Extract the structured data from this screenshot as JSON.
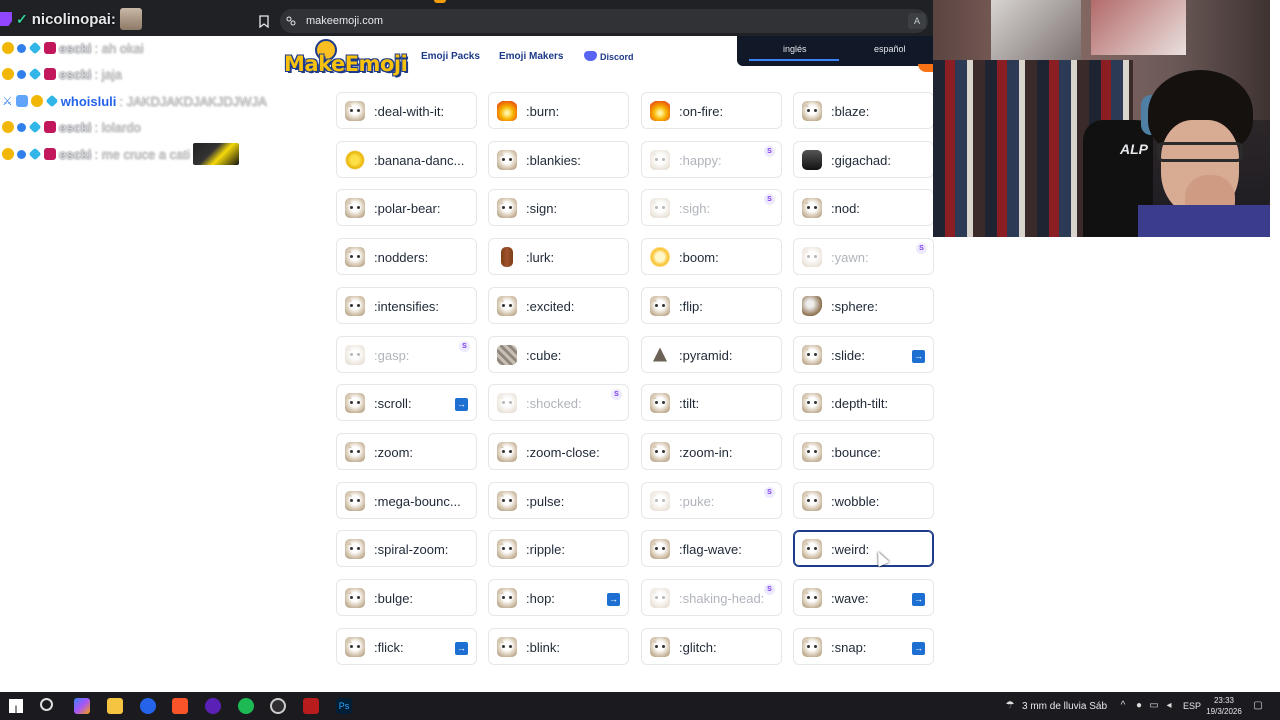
{
  "browser": {
    "url": "makeemoji.com"
  },
  "chat": {
    "top_user": "nicolinopai:",
    "lines": [
      {
        "user": "escki",
        "message": ": ah okai"
      },
      {
        "user": "escki",
        "message": ": jaja"
      },
      {
        "user": "whoisluli",
        "message": ": JAKDJAKDJAKJDJWJA"
      },
      {
        "user": "escki",
        "message": ": lolardo"
      },
      {
        "user": "escki",
        "message": ": me cruce a cati"
      }
    ]
  },
  "site": {
    "logo": "MakeEmoji",
    "nav": {
      "emoji_packs": "Emoji Packs",
      "emoji_makers": "Emoji Makers",
      "discord": "Discord"
    },
    "language": {
      "option1": "inglés",
      "option2": "español",
      "selected": "inglés"
    }
  },
  "emojis": [
    {
      "name": ":deal-with-it:",
      "thumb": "cat"
    },
    {
      "name": ":burn:",
      "thumb": "fire"
    },
    {
      "name": ":on-fire:",
      "thumb": "fire"
    },
    {
      "name": ":blaze:",
      "thumb": "cat"
    },
    {
      "name": ":banana-danc...",
      "thumb": "banana"
    },
    {
      "name": ":blankies:",
      "thumb": "cat"
    },
    {
      "name": ":happy:",
      "thumb": "cat",
      "dim": true,
      "s": "S"
    },
    {
      "name": ":gigachad:",
      "thumb": "dark"
    },
    {
      "name": ":polar-bear:",
      "thumb": "cat"
    },
    {
      "name": ":sign:",
      "thumb": "cat"
    },
    {
      "name": ":sigh:",
      "thumb": "cat",
      "dim": true,
      "s": "S"
    },
    {
      "name": ":nod:",
      "thumb": "cat"
    },
    {
      "name": ":nodders:",
      "thumb": "cat"
    },
    {
      "name": ":lurk:",
      "thumb": "wood"
    },
    {
      "name": ":boom:",
      "thumb": "boom"
    },
    {
      "name": ":yawn:",
      "thumb": "cat",
      "dim": true,
      "s": "S"
    },
    {
      "name": ":intensifies:",
      "thumb": "cat"
    },
    {
      "name": ":excited:",
      "thumb": "cat"
    },
    {
      "name": ":flip:",
      "thumb": "cat"
    },
    {
      "name": ":sphere:",
      "thumb": "sphere"
    },
    {
      "name": ":gasp:",
      "thumb": "cat",
      "dim": true,
      "s": "S"
    },
    {
      "name": ":cube:",
      "thumb": "cube"
    },
    {
      "name": ":pyramid:",
      "thumb": "pyramid"
    },
    {
      "name": ":slide:",
      "thumb": "cat",
      "anim": "→"
    },
    {
      "name": ":scroll:",
      "thumb": "cat",
      "anim": "→"
    },
    {
      "name": ":shocked:",
      "thumb": "cat",
      "dim": true,
      "s": "S"
    },
    {
      "name": ":tilt:",
      "thumb": "cat"
    },
    {
      "name": ":depth-tilt:",
      "thumb": "cat"
    },
    {
      "name": ":zoom:",
      "thumb": "cat"
    },
    {
      "name": ":zoom-close:",
      "thumb": "cat"
    },
    {
      "name": ":zoom-in:",
      "thumb": "cat"
    },
    {
      "name": ":bounce:",
      "thumb": "cat"
    },
    {
      "name": ":mega-bounc...",
      "thumb": "cat"
    },
    {
      "name": ":pulse:",
      "thumb": "cat"
    },
    {
      "name": ":puke:",
      "thumb": "cat",
      "dim": true,
      "s": "S"
    },
    {
      "name": ":wobble:",
      "thumb": "cat"
    },
    {
      "name": ":spiral-zoom:",
      "thumb": "cat"
    },
    {
      "name": ":ripple:",
      "thumb": "cat"
    },
    {
      "name": ":flag-wave:",
      "thumb": "cat"
    },
    {
      "name": ":weird:",
      "thumb": "cat",
      "selected": true
    },
    {
      "name": ":bulge:",
      "thumb": "cat"
    },
    {
      "name": ":hop:",
      "thumb": "cat",
      "anim": "→"
    },
    {
      "name": ":shaking-head:",
      "thumb": "cat",
      "dim": true,
      "s": "S"
    },
    {
      "name": ":wave:",
      "thumb": "cat",
      "anim": "→"
    },
    {
      "name": ":flick:",
      "thumb": "cat",
      "anim": "→"
    },
    {
      "name": ":blink:",
      "thumb": "cat"
    },
    {
      "name": ":glitch:",
      "thumb": "cat"
    },
    {
      "name": ":snap:",
      "thumb": "cat",
      "anim": "→"
    }
  ],
  "webcam": {
    "chair_text": "ALP"
  },
  "taskbar": {
    "weather": "3 mm de lluvia Sáb",
    "lang": "ESP",
    "time": "23:33",
    "date": "19/3/2026"
  },
  "colors": {
    "accent": "#1e3a8a",
    "logo_yellow": "#f7c10d",
    "anim_badge": "#1d6fd1",
    "s_badge": "#7c3aed"
  }
}
